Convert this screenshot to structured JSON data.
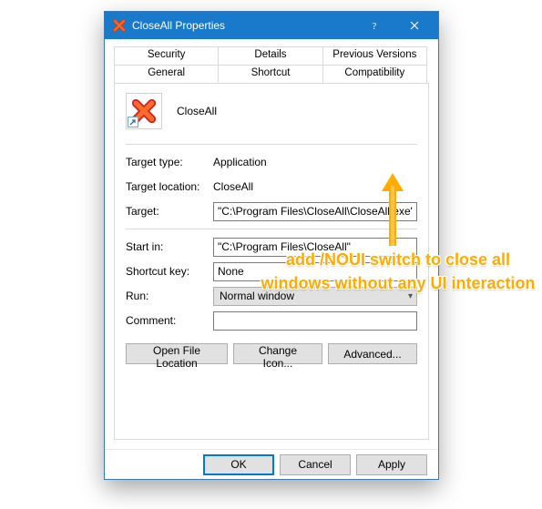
{
  "window": {
    "title": "CloseAll Properties"
  },
  "tabs": {
    "row1": [
      "Security",
      "Details",
      "Previous Versions"
    ],
    "row2": [
      "General",
      "Shortcut",
      "Compatibility"
    ],
    "active": "Shortcut"
  },
  "header": {
    "name": "CloseAll"
  },
  "fields": {
    "target_type": {
      "label": "Target type:",
      "value": "Application"
    },
    "target_location": {
      "label": "Target location:",
      "value": "CloseAll"
    },
    "target": {
      "label": "Target:",
      "value": "\"C:\\Program Files\\CloseAll\\CloseAll.exe\" /NOUI"
    },
    "start_in": {
      "label": "Start in:",
      "value": "\"C:\\Program Files\\CloseAll\""
    },
    "shortcut_key": {
      "label": "Shortcut key:",
      "value": "None"
    },
    "run": {
      "label": "Run:",
      "value": "Normal window"
    },
    "comment": {
      "label": "Comment:",
      "value": ""
    }
  },
  "buttons": {
    "open_location": "Open File Location",
    "change_icon": "Change Icon...",
    "advanced": "Advanced...",
    "ok": "OK",
    "cancel": "Cancel",
    "apply": "Apply"
  },
  "annotation": {
    "text": "add /NOUI switch to close all windows without any UI interaction"
  }
}
